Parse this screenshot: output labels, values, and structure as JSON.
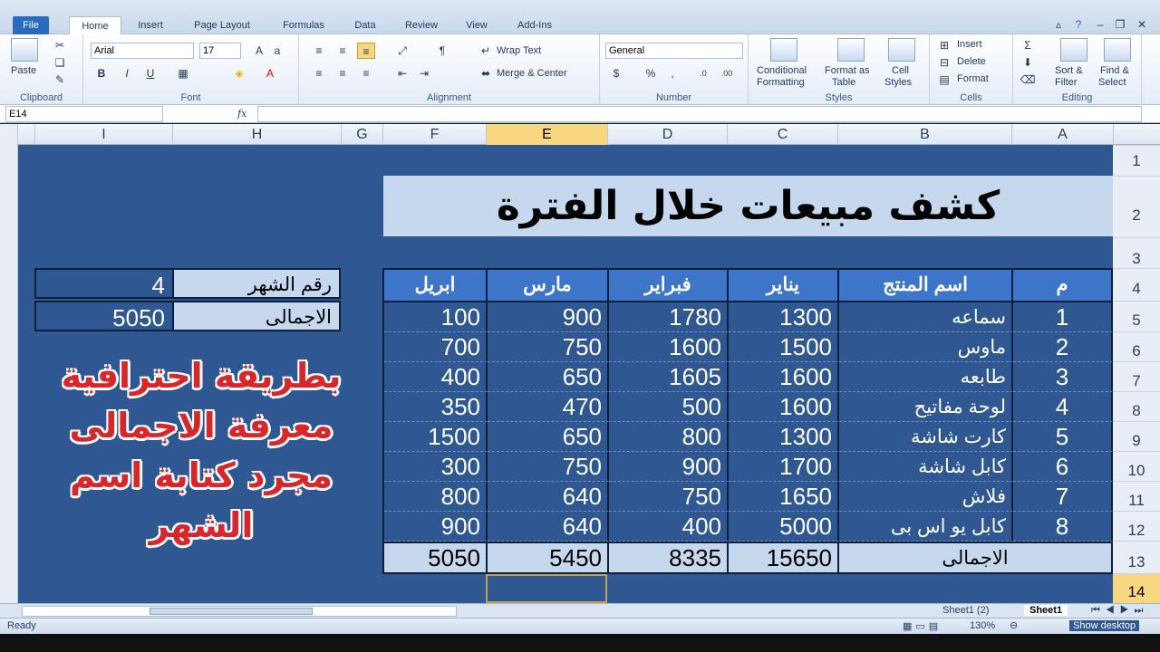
{
  "ribbon_tabs": [
    "File",
    "Home",
    "Insert",
    "Page Layout",
    "Formulas",
    "Data",
    "Review",
    "View",
    "Add-Ins"
  ],
  "clipboard": {
    "paste": "Paste",
    "label": "Clipboard"
  },
  "font": {
    "name": "Arial",
    "size": "17",
    "label": "Font",
    "bold": "B",
    "italic": "I",
    "underline": "U"
  },
  "alignment": {
    "wrap": "Wrap Text",
    "merge": "Merge & Center",
    "label": "Alignment"
  },
  "number": {
    "format": "General",
    "label": "Number",
    "percent": "%",
    "comma": ","
  },
  "styles": {
    "cond1": "Conditional",
    "cond2": "Formatting",
    "fmt1": "Format as",
    "fmt2": "Table",
    "cell1": "Cell",
    "cell2": "Styles",
    "label": "Styles"
  },
  "cells": {
    "insert": "Insert",
    "delete": "Delete",
    "format": "Format",
    "label": "Cells"
  },
  "editing": {
    "sort1": "Sort &",
    "sort2": "Filter",
    "find1": "Find &",
    "find2": "Select",
    "label": "Editing",
    "sigma": "Σ"
  },
  "formula_bar": {
    "name_box": "E14",
    "fx": "fx",
    "value": ""
  },
  "columns": [
    "I",
    "H",
    "G",
    "F",
    "E",
    "D",
    "C",
    "B",
    "A"
  ],
  "rows": [
    "1",
    "2",
    "3",
    "4",
    "5",
    "6",
    "7",
    "8",
    "9",
    "10",
    "11",
    "12",
    "13",
    "14"
  ],
  "sheet": {
    "title": "كشف مبيعات خلال الفترة",
    "headers": [
      "م",
      "اسم المنتج",
      "يناير",
      "فبراير",
      "مارس",
      "ابريل"
    ],
    "products": [
      {
        "n": "1",
        "name": "سماعه",
        "jan": "1300",
        "feb": "1780",
        "mar": "900",
        "apr": "100"
      },
      {
        "n": "2",
        "name": "ماوس",
        "jan": "1500",
        "feb": "1600",
        "mar": "750",
        "apr": "700"
      },
      {
        "n": "3",
        "name": "طابعه",
        "jan": "1600",
        "feb": "1605",
        "mar": "650",
        "apr": "400"
      },
      {
        "n": "4",
        "name": "لوحة مفاتيح",
        "jan": "1600",
        "feb": "500",
        "mar": "470",
        "apr": "350"
      },
      {
        "n": "5",
        "name": "كارت شاشة",
        "jan": "1300",
        "feb": "800",
        "mar": "650",
        "apr": "1500"
      },
      {
        "n": "6",
        "name": "كابل شاشة",
        "jan": "1700",
        "feb": "900",
        "mar": "750",
        "apr": "300"
      },
      {
        "n": "7",
        "name": "فلاش",
        "jan": "1650",
        "feb": "750",
        "mar": "640",
        "apr": "800"
      },
      {
        "n": "8",
        "name": "كابل يو اس بى",
        "jan": "5000",
        "feb": "400",
        "mar": "640",
        "apr": "900"
      }
    ],
    "total": {
      "label": "الاجمالى",
      "jan": "15650",
      "feb": "8335",
      "mar": "5450",
      "apr": "5050"
    },
    "lookup": {
      "month_label": "رقم الشهر",
      "month_value": "4",
      "total_label": "الاجمالى",
      "total_value": "5050"
    },
    "promo": [
      "بطريقة احترافية",
      "معرفة الاجمالى",
      "مجرد كتابة اسم",
      "الشهر"
    ]
  },
  "sheet_tabs": [
    "Sheet1 (2)",
    "Sheet1"
  ],
  "status": {
    "ready": "Ready",
    "zoom": "130%",
    "show_desktop": "Show desktop"
  },
  "colors": {
    "sheet_bg": "#2f5893",
    "header_bg": "#3d76c9",
    "title_bg": "#c6d8ee",
    "promo": "#d9262b",
    "selection": "#f8d77e"
  }
}
